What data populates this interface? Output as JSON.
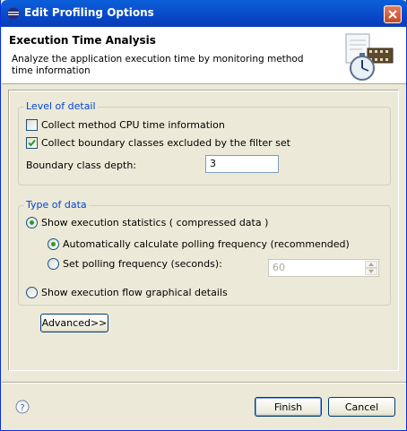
{
  "window": {
    "title": "Edit Profiling Options",
    "accent": "#0a55d1",
    "close_icon": "close-icon"
  },
  "banner": {
    "title": "Execution Time Analysis",
    "description": "Analyze the application execution time by monitoring method time information",
    "icon": "stopwatch-film-icon"
  },
  "level_of_detail": {
    "label": "Level of detail",
    "collect_cpu_time": {
      "label": "Collect method CPU time information",
      "checked": false
    },
    "collect_boundary": {
      "label": "Collect boundary classes excluded by the filter set",
      "checked": true
    },
    "boundary_depth": {
      "label": "Boundary class depth:",
      "value": "3"
    }
  },
  "type_of_data": {
    "label": "Type of data",
    "show_stats": {
      "label": "Show execution statistics ( compressed data )",
      "selected": true
    },
    "auto_poll": {
      "label": "Automatically calculate polling frequency (recommended)",
      "selected": true
    },
    "set_poll": {
      "label": "Set polling frequency (seconds):",
      "selected": false,
      "value": "60"
    },
    "show_flow": {
      "label": "Show execution flow graphical details",
      "selected": false
    }
  },
  "buttons": {
    "advanced": "Advanced>>",
    "finish": "Finish",
    "cancel": "Cancel"
  }
}
